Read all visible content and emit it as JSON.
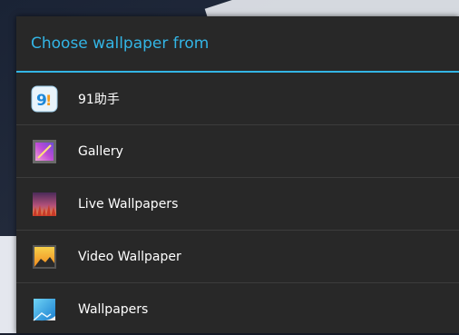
{
  "dialog": {
    "title": "Choose wallpaper from",
    "items": [
      {
        "label": "91助手",
        "icon": "91-assistant-icon"
      },
      {
        "label": "Gallery",
        "icon": "gallery-icon"
      },
      {
        "label": "Live Wallpapers",
        "icon": "live-wallpapers-icon"
      },
      {
        "label": "Video Wallpaper",
        "icon": "video-wallpaper-icon"
      },
      {
        "label": "Wallpapers",
        "icon": "wallpapers-icon"
      }
    ]
  },
  "colors": {
    "accent": "#33b5e5",
    "dialog_bg": "#282828",
    "divider": "#3c3c3c"
  }
}
